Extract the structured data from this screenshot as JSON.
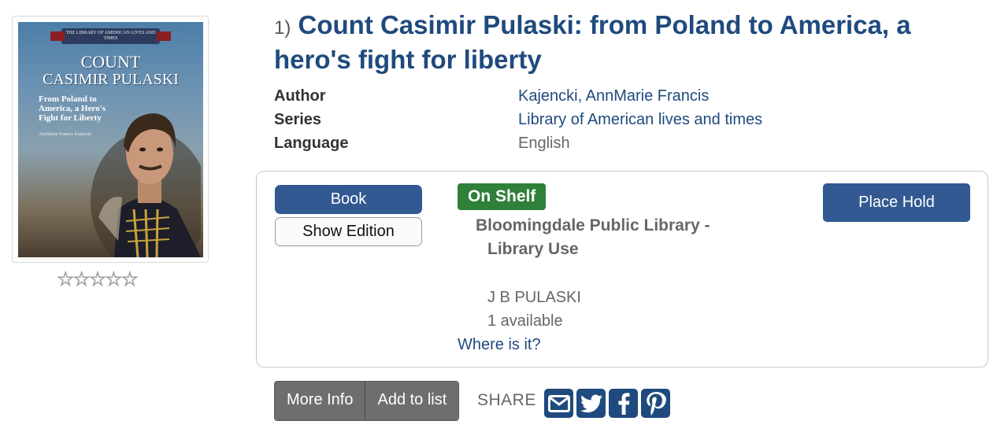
{
  "result": {
    "number": "1)",
    "title": "Count Casimir Pulaski: from Poland to America, a hero's fight for liberty",
    "cover": {
      "series_ribbon": "THE LIBRARY OF AMERICAN LIVES AND TIMES",
      "title_line1": "COUNT",
      "title_line2": "CASIMIR PULASKI",
      "subtitle": "From Poland to America, a Hero's Fight for Liberty",
      "author": "AnnMarie Francis Kajencki"
    },
    "rating": "☆☆☆☆☆"
  },
  "details": {
    "author_label": "Author",
    "author_value": "Kajencki, AnnMarie Francis",
    "series_label": "Series",
    "series_value": "Library of American lives and times",
    "language_label": "Language",
    "language_value": "English"
  },
  "holdings": {
    "format_button": "Book",
    "edition_button": "Show Edition",
    "status_badge": "On Shelf",
    "location_line1": "Bloomingdale Public Library -",
    "location_line2": "Library Use",
    "call_number": "J B PULASKI",
    "availability": "1 available",
    "where_link": "Where is it?",
    "hold_button": "Place Hold"
  },
  "actions": {
    "more_info": "More Info",
    "add_to_list": "Add to list",
    "share_label": "SHARE",
    "share_icons": [
      "email-icon",
      "twitter-icon",
      "facebook-icon",
      "pinterest-icon"
    ]
  },
  "colors": {
    "link_blue": "#1f4a7e",
    "button_blue": "#325992",
    "status_green": "#2f8039",
    "action_gray": "#6e6e6e"
  }
}
